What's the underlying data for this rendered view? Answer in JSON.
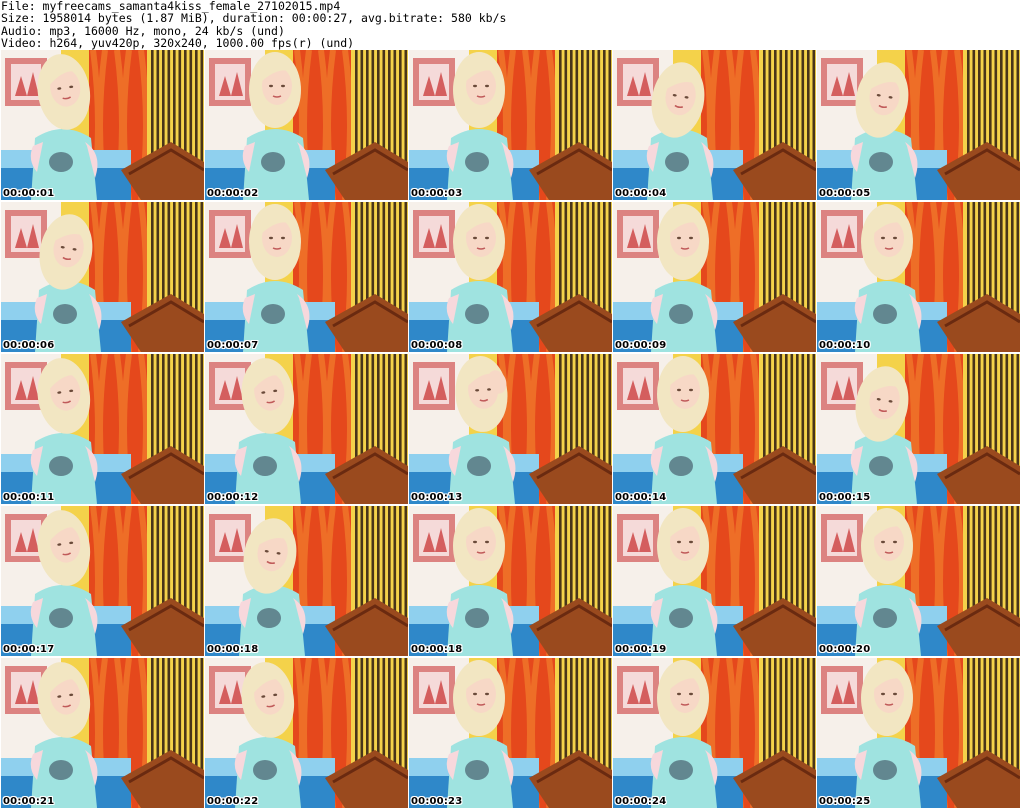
{
  "header": {
    "file_line": "File: myfreecams_samanta4kiss_female_27102015.mp4",
    "size_line": "Size: 1958014 bytes (1.87 MiB), duration: 00:00:27, avg.bitrate: 580 kb/s",
    "audio_line": "Audio: mp3, 16000 Hz, mono, 24 kb/s (und)",
    "video_line": "Video: h264, yuv420p, 320x240, 1000.00 fps(r) (und)"
  },
  "thumbnails": [
    {
      "timestamp": "00:00:01",
      "pose": "left"
    },
    {
      "timestamp": "00:00:02",
      "pose": "center"
    },
    {
      "timestamp": "00:00:03",
      "pose": "center"
    },
    {
      "timestamp": "00:00:04",
      "pose": "down"
    },
    {
      "timestamp": "00:00:05",
      "pose": "down"
    },
    {
      "timestamp": "00:00:06",
      "pose": "down"
    },
    {
      "timestamp": "00:00:07",
      "pose": "center"
    },
    {
      "timestamp": "00:00:08",
      "pose": "center"
    },
    {
      "timestamp": "00:00:09",
      "pose": "center"
    },
    {
      "timestamp": "00:00:10",
      "pose": "center"
    },
    {
      "timestamp": "00:00:11",
      "pose": "left"
    },
    {
      "timestamp": "00:00:12",
      "pose": "left"
    },
    {
      "timestamp": "00:00:13",
      "pose": "hand"
    },
    {
      "timestamp": "00:00:14",
      "pose": "center"
    },
    {
      "timestamp": "00:00:15",
      "pose": "down"
    },
    {
      "timestamp": "00:00:17",
      "pose": "left"
    },
    {
      "timestamp": "00:00:18",
      "pose": "down"
    },
    {
      "timestamp": "00:00:18",
      "pose": "center"
    },
    {
      "timestamp": "00:00:19",
      "pose": "center"
    },
    {
      "timestamp": "00:00:20",
      "pose": "center"
    },
    {
      "timestamp": "00:00:21",
      "pose": "left"
    },
    {
      "timestamp": "00:00:22",
      "pose": "left"
    },
    {
      "timestamp": "00:00:23",
      "pose": "center"
    },
    {
      "timestamp": "00:00:24",
      "pose": "center"
    },
    {
      "timestamp": "00:00:25",
      "pose": "center"
    }
  ],
  "colors": {
    "wall_orange": "#f0782a",
    "wall_yellow": "#f4d24a",
    "curtain_red": "#e5481c",
    "poster_bg": "#f6f0ea",
    "poster_accent": "#c62a2a",
    "couch_blue": "#2f88c9",
    "couch_light": "#8fd0ee",
    "wood_brown": "#9a4a1e",
    "shirt_teal": "#9fe3e0",
    "shirt_pink": "#f7d8dc",
    "hair_blonde": "#f2e6c2",
    "skin": "#f7d8c6"
  }
}
